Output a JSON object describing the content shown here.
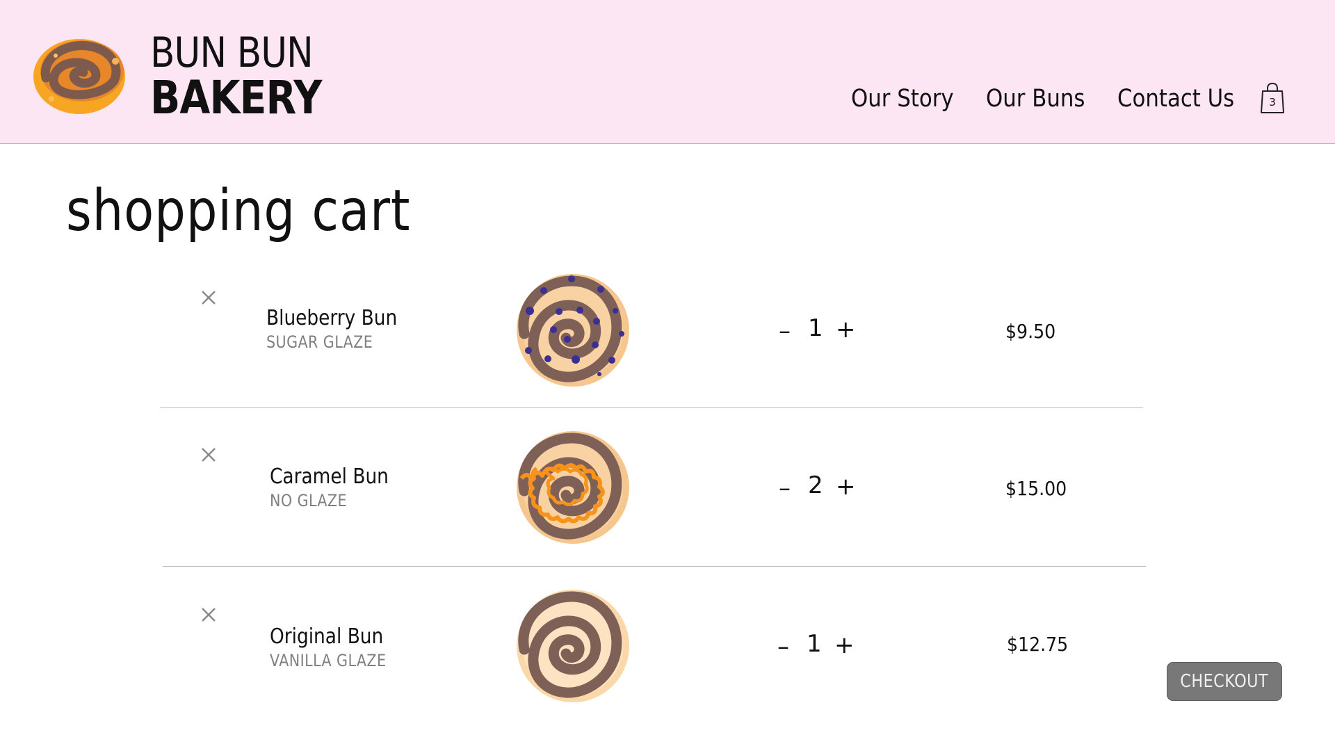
{
  "brand": {
    "line1": "BUN BUN",
    "line2": "BAKERY"
  },
  "nav": {
    "links": [
      "Our Story",
      "Our Buns",
      "Contact Us"
    ],
    "cart_count": "3"
  },
  "page": {
    "title": "shopping cart"
  },
  "cart": {
    "items": [
      {
        "name": "Blueberry Bun",
        "glaze": "SUGAR GLAZE",
        "quantity": "1",
        "price": "$9.50",
        "image": "blueberry-bun-icon"
      },
      {
        "name": "Caramel Bun",
        "glaze": "NO GLAZE",
        "quantity": "2",
        "price": "$15.00",
        "image": "caramel-bun-icon"
      },
      {
        "name": "Original Bun",
        "glaze": "VANILLA GLAZE",
        "quantity": "1",
        "price": "$12.75",
        "image": "original-bun-icon"
      }
    ],
    "minus_symbol": "–",
    "plus_symbol": "+"
  },
  "checkout": {
    "label": "CHECKOUT"
  },
  "colors": {
    "header_bg": "#fde6f3",
    "checkout_bg": "#787878",
    "glaze_text": "#808080"
  }
}
